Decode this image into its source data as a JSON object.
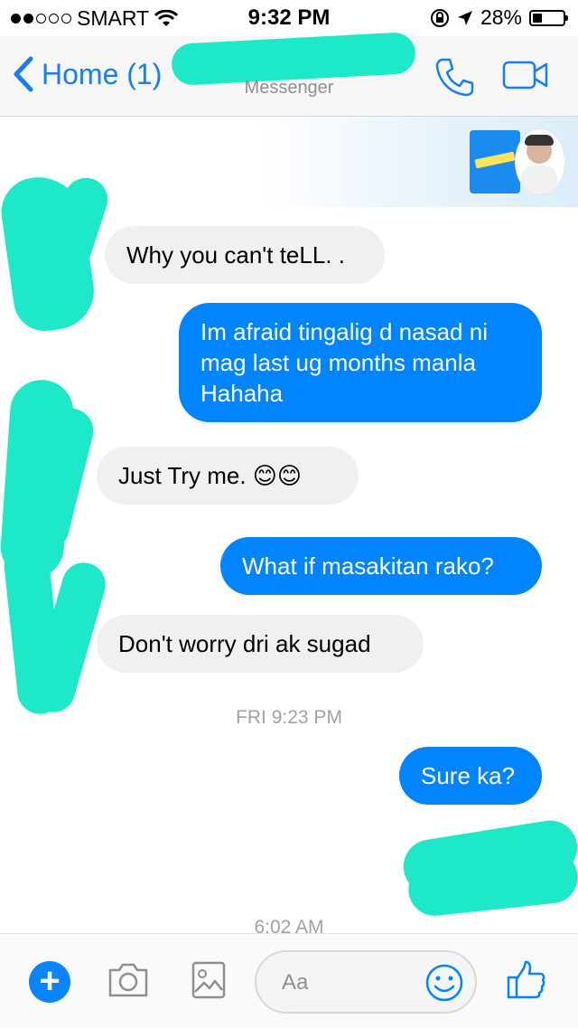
{
  "status_bar": {
    "carrier": "SMART",
    "time": "9:32 PM",
    "battery": "28%"
  },
  "nav": {
    "back_label": "Home (1)",
    "subtitle": "Messenger"
  },
  "messages": [
    {
      "side": "in",
      "text": "Why you can't teLL. ."
    },
    {
      "side": "out",
      "text": "Im afraid tingalig d nasad ni\nmag last ug months manla\nHahaha"
    },
    {
      "side": "in",
      "text": "Just Try me. 😊😊"
    },
    {
      "side": "out",
      "text": "What if masakitan rako?"
    },
    {
      "side": "in",
      "text": "Don't worry dri ak sugad"
    },
    {
      "side": "out",
      "text": "Sure ka?"
    }
  ],
  "timestamps": [
    "FRI 9:23 PM",
    "6:02 AM"
  ],
  "composer": {
    "placeholder": "Aa"
  },
  "colors": {
    "accent": "#0084ff",
    "ios_blue": "#157efb",
    "incoming_bubble": "#f1f0f0",
    "redaction": "#1de9c8"
  },
  "icons": [
    "chevron-left-icon",
    "phone-icon",
    "video-camera-icon",
    "wifi-icon",
    "rotation-lock-icon",
    "location-arrow-icon",
    "battery-icon",
    "plus-icon",
    "camera-icon",
    "gallery-icon",
    "emoji-icon",
    "thumbs-up-icon"
  ]
}
